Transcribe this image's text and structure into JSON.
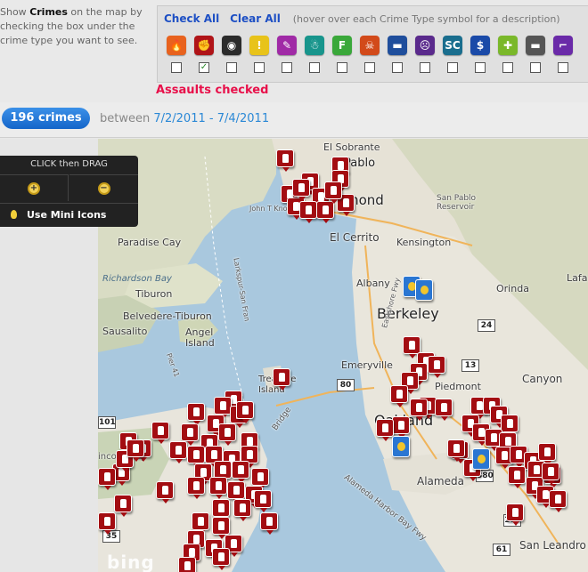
{
  "instructions": {
    "before": "Show ",
    "bold": "Crimes",
    "after": " on the map by checking the box under the crime type you want to see."
  },
  "links": {
    "check_all": "Check All",
    "clear_all": "Clear All",
    "hint": "(hover over each Crime Type symbol for a description)"
  },
  "crime_types": [
    {
      "icon": "arson-flame-icon",
      "glyph": "🔥",
      "color": "#e8621e",
      "checked": false
    },
    {
      "icon": "assault-fist-icon",
      "glyph": "✊",
      "color": "#b01418",
      "checked": true
    },
    {
      "icon": "burglary-mask-icon",
      "glyph": "◉",
      "color": "#2b2b2b",
      "checked": false
    },
    {
      "icon": "disturbing-peace-icon",
      "glyph": "!",
      "color": "#e8c31a",
      "checked": false
    },
    {
      "icon": "drugs-syringe-icon",
      "glyph": "✎",
      "color": "#a02aa6",
      "checked": false
    },
    {
      "icon": "dui-icon",
      "glyph": "☃",
      "color": "#18958c",
      "checked": false
    },
    {
      "icon": "fraud-icon",
      "glyph": "F",
      "color": "#3aa83a",
      "checked": false
    },
    {
      "icon": "homicide-icon",
      "glyph": "☠",
      "color": "#d24a1a",
      "checked": false
    },
    {
      "icon": "motor-vehicle-theft-icon",
      "glyph": "▬",
      "color": "#1f4e9c",
      "checked": false
    },
    {
      "icon": "robbery-skull-icon",
      "glyph": "☹",
      "color": "#5a2a8c",
      "checked": false
    },
    {
      "icon": "sex-crimes-icon",
      "glyph": "SC",
      "color": "#1a6e8e",
      "checked": false
    },
    {
      "icon": "theft-dollar-icon",
      "glyph": "$",
      "color": "#1a4aa8",
      "checked": false
    },
    {
      "icon": "vandalism-spray-icon",
      "glyph": "✚",
      "color": "#7ab82a",
      "checked": false
    },
    {
      "icon": "vehicle-break-in-icon",
      "glyph": "▬",
      "color": "#555555",
      "checked": false
    },
    {
      "icon": "weapons-gun-icon",
      "glyph": "⌐",
      "color": "#6a2aa8",
      "checked": false
    }
  ],
  "status_checked": "Assaults checked",
  "count": {
    "pill": "196 crimes",
    "between_label": "between ",
    "date_range": "7/2/2011 - 7/4/2011"
  },
  "map_control": {
    "title": "CLICK then DRAG",
    "zoom_in": "+",
    "zoom_out": "−",
    "mini_icons": "Use Mini Icons"
  },
  "map_labels": {
    "el_sobrante": "El Sobrante",
    "pablo": "Pablo",
    "richmond": "mond",
    "el_cerrito": "El Cerrito",
    "kensington": "Kensington",
    "paradise_cay": "Paradise Cay",
    "richardson_bay": "Richardson Bay",
    "tiburon": "Tiburon",
    "belvedere": "Belvedere-Tiburon",
    "sausalito": "Sausalito",
    "angel_island": "Angel Island",
    "albany": "Albany",
    "berkeley": "Berkeley",
    "emeryville": "Emeryville",
    "piedmont": "Piedmont",
    "oakland": "Oakland",
    "alameda": "Alameda",
    "orinda": "Orinda",
    "lafay": "Lafa",
    "canyon": "Canyon",
    "san_leandro": "San Leandro",
    "san_pablo_reservoir": "San Pablo Reservoir",
    "treasure_island": "Treasure Island",
    "john_t_knox_fwy": "John T Knox Fwy",
    "eastshore_fwy": "Eastshore Fwy",
    "lincoln_way": "incoln Way",
    "bay_bridge": "Bridge",
    "alameda_harbor": "Alameda Harbor Bay Fwy",
    "pier_41": "Pier 41",
    "larkspur": "Larkspur-San Fran",
    "bing": "bing"
  },
  "shields": [
    "101",
    "80",
    "13",
    "24",
    "880",
    "185",
    "61",
    "35"
  ]
}
